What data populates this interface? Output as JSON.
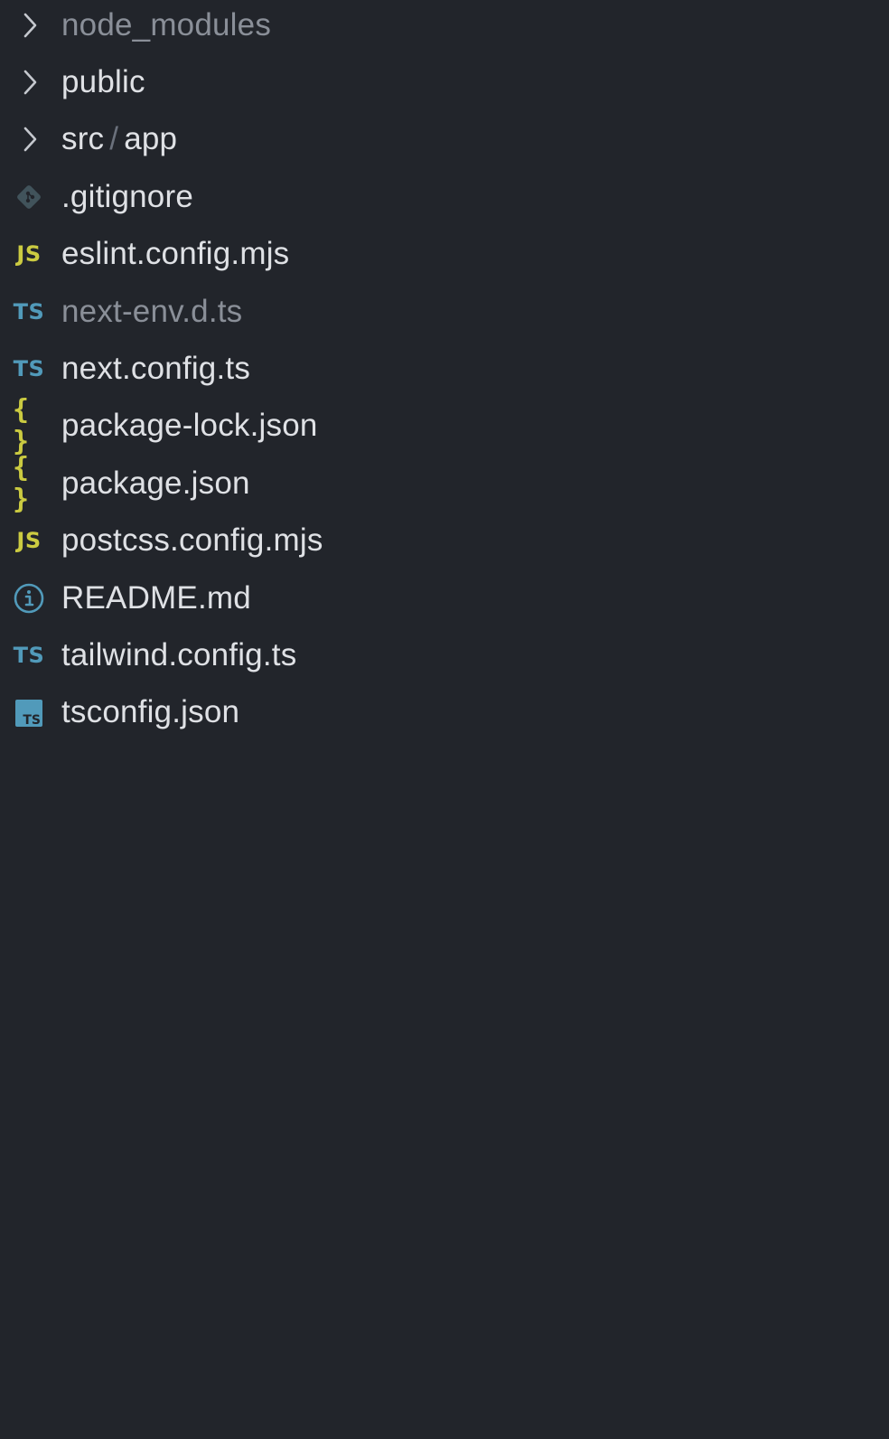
{
  "explorer": {
    "items": [
      {
        "label": "node_modules",
        "kind": "folder",
        "icon": "chevron-right-icon",
        "dimmed": true
      },
      {
        "label": "public",
        "kind": "folder",
        "icon": "chevron-right-icon",
        "dimmed": false
      },
      {
        "label_parts": [
          "src",
          "/",
          "app"
        ],
        "kind": "folder",
        "icon": "chevron-right-icon",
        "dimmed": false
      },
      {
        "label": ".gitignore",
        "kind": "file",
        "icon": "git-icon",
        "dimmed": false
      },
      {
        "label": "eslint.config.mjs",
        "kind": "file",
        "icon": "javascript-icon",
        "icon_text": "JS",
        "dimmed": false
      },
      {
        "label": "next-env.d.ts",
        "kind": "file",
        "icon": "typescript-icon",
        "icon_text": "TS",
        "dimmed": true
      },
      {
        "label": "next.config.ts",
        "kind": "file",
        "icon": "typescript-icon",
        "icon_text": "TS",
        "dimmed": false
      },
      {
        "label": "package-lock.json",
        "kind": "file",
        "icon": "json-icon",
        "icon_text": "{ }",
        "dimmed": false
      },
      {
        "label": "package.json",
        "kind": "file",
        "icon": "json-icon",
        "icon_text": "{ }",
        "dimmed": false
      },
      {
        "label": "postcss.config.mjs",
        "kind": "file",
        "icon": "javascript-icon",
        "icon_text": "JS",
        "dimmed": false
      },
      {
        "label": "README.md",
        "kind": "file",
        "icon": "info-icon",
        "dimmed": false
      },
      {
        "label": "tailwind.config.ts",
        "kind": "file",
        "icon": "typescript-icon",
        "icon_text": "TS",
        "dimmed": false
      },
      {
        "label": "tsconfig.json",
        "kind": "file",
        "icon": "tsconfig-icon",
        "icon_text": "TS",
        "dimmed": false
      }
    ]
  },
  "colors": {
    "background": "#22252b",
    "text": "#dfe1e5",
    "dimmed_text": "#8a8f98",
    "js_yellow": "#cbcb41",
    "ts_blue": "#519aba",
    "git_gray": "#41535b",
    "chevron": "#c5c8ce"
  }
}
